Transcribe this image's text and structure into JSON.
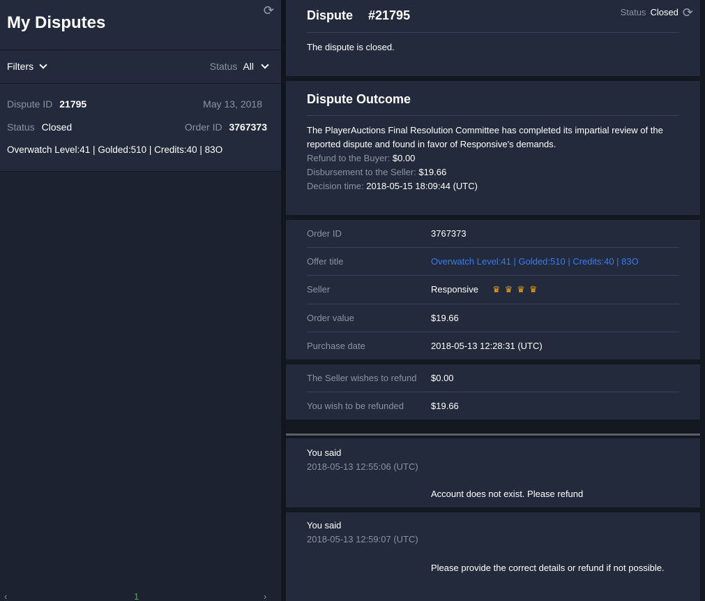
{
  "sidebar": {
    "title": "My Disputes",
    "filters_label": "Filters",
    "status_label": "Status",
    "status_value": "All",
    "dispute": {
      "id_label": "Dispute ID",
      "id_value": "21795",
      "date": "May 13, 2018",
      "status_label": "Status",
      "status_value": "Closed",
      "order_label": "Order ID",
      "order_value": "3767373",
      "offer": "Overwatch Level:41 | Golded:510 | Credits:40 | 83O"
    },
    "pager": {
      "prev": "‹",
      "page": "1",
      "next": "›"
    }
  },
  "dispute_header": {
    "title": "Dispute",
    "number": "#21795",
    "status_label": "Status",
    "status_value": "Closed",
    "message": "The dispute is closed."
  },
  "outcome": {
    "title": "Dispute Outcome",
    "text": "The PlayerAuctions Final Resolution Committee has completed its impartial review of the reported dispute and found in favor of Responsive's demands.",
    "refund_label": "Refund to the Buyer:",
    "refund_value": "$0.00",
    "disbursement_label": "Disbursement to the Seller:",
    "disbursement_value": "$19.66",
    "decision_label": "Decision time:",
    "decision_value": "2018-05-15 18:09:44 (UTC)"
  },
  "order": {
    "order_id_label": "Order ID",
    "order_id_value": "3767373",
    "offer_title_label": "Offer title",
    "offer_title_value": "Overwatch Level:41 | Golded:510 | Credits:40 | 83O",
    "seller_label": "Seller",
    "seller_value": "Responsive",
    "seller_crowns": "♛♛♛♛",
    "order_value_label": "Order value",
    "order_value_value": "$19.66",
    "purchase_date_label": "Purchase date",
    "purchase_date_value": "2018-05-13 12:28:31 (UTC)"
  },
  "refund": {
    "seller_wishes_label": "The Seller wishes to refund",
    "seller_wishes_value": "$0.00",
    "you_wish_label": "You wish to be refunded",
    "you_wish_value": "$19.66"
  },
  "messages": [
    {
      "author": "You said",
      "time": "2018-05-13 12:55:06 (UTC)",
      "text": "Account does not exist. Please refund"
    },
    {
      "author": "You said",
      "time": "2018-05-13 12:59:07 (UTC)",
      "text": "Please provide the correct details or refund if not possible."
    }
  ],
  "colors": {
    "link": "#3a7bf0",
    "crown": "#f0a51c",
    "pager_active": "#4caf50"
  }
}
